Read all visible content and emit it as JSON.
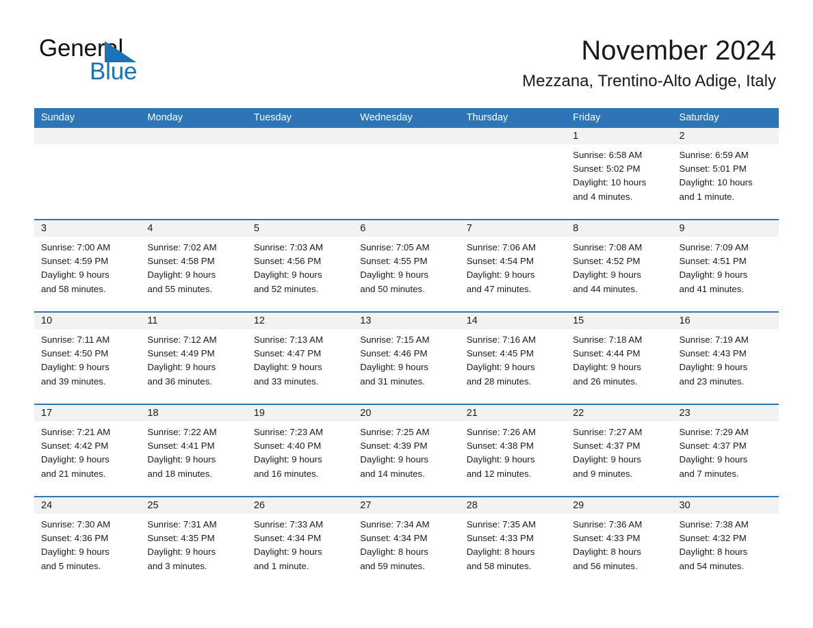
{
  "brand": {
    "line1": "General",
    "line2": "Blue",
    "triangle_color": "#1b72b8"
  },
  "header": {
    "month_title": "November 2024",
    "location": "Mezzana, Trentino-Alto Adige, Italy"
  },
  "colors": {
    "header_blue": "#2e75b6",
    "day_band_gray": "#f2f2f2",
    "text": "#1a1a1a"
  },
  "weekdays": [
    "Sunday",
    "Monday",
    "Tuesday",
    "Wednesday",
    "Thursday",
    "Friday",
    "Saturday"
  ],
  "weeks": [
    [
      {
        "day": "",
        "sunrise": "",
        "sunset": "",
        "daylight_1": "",
        "daylight_2": ""
      },
      {
        "day": "",
        "sunrise": "",
        "sunset": "",
        "daylight_1": "",
        "daylight_2": ""
      },
      {
        "day": "",
        "sunrise": "",
        "sunset": "",
        "daylight_1": "",
        "daylight_2": ""
      },
      {
        "day": "",
        "sunrise": "",
        "sunset": "",
        "daylight_1": "",
        "daylight_2": ""
      },
      {
        "day": "",
        "sunrise": "",
        "sunset": "",
        "daylight_1": "",
        "daylight_2": ""
      },
      {
        "day": "1",
        "sunrise": "Sunrise: 6:58 AM",
        "sunset": "Sunset: 5:02 PM",
        "daylight_1": "Daylight: 10 hours",
        "daylight_2": "and 4 minutes."
      },
      {
        "day": "2",
        "sunrise": "Sunrise: 6:59 AM",
        "sunset": "Sunset: 5:01 PM",
        "daylight_1": "Daylight: 10 hours",
        "daylight_2": "and 1 minute."
      }
    ],
    [
      {
        "day": "3",
        "sunrise": "Sunrise: 7:00 AM",
        "sunset": "Sunset: 4:59 PM",
        "daylight_1": "Daylight: 9 hours",
        "daylight_2": "and 58 minutes."
      },
      {
        "day": "4",
        "sunrise": "Sunrise: 7:02 AM",
        "sunset": "Sunset: 4:58 PM",
        "daylight_1": "Daylight: 9 hours",
        "daylight_2": "and 55 minutes."
      },
      {
        "day": "5",
        "sunrise": "Sunrise: 7:03 AM",
        "sunset": "Sunset: 4:56 PM",
        "daylight_1": "Daylight: 9 hours",
        "daylight_2": "and 52 minutes."
      },
      {
        "day": "6",
        "sunrise": "Sunrise: 7:05 AM",
        "sunset": "Sunset: 4:55 PM",
        "daylight_1": "Daylight: 9 hours",
        "daylight_2": "and 50 minutes."
      },
      {
        "day": "7",
        "sunrise": "Sunrise: 7:06 AM",
        "sunset": "Sunset: 4:54 PM",
        "daylight_1": "Daylight: 9 hours",
        "daylight_2": "and 47 minutes."
      },
      {
        "day": "8",
        "sunrise": "Sunrise: 7:08 AM",
        "sunset": "Sunset: 4:52 PM",
        "daylight_1": "Daylight: 9 hours",
        "daylight_2": "and 44 minutes."
      },
      {
        "day": "9",
        "sunrise": "Sunrise: 7:09 AM",
        "sunset": "Sunset: 4:51 PM",
        "daylight_1": "Daylight: 9 hours",
        "daylight_2": "and 41 minutes."
      }
    ],
    [
      {
        "day": "10",
        "sunrise": "Sunrise: 7:11 AM",
        "sunset": "Sunset: 4:50 PM",
        "daylight_1": "Daylight: 9 hours",
        "daylight_2": "and 39 minutes."
      },
      {
        "day": "11",
        "sunrise": "Sunrise: 7:12 AM",
        "sunset": "Sunset: 4:49 PM",
        "daylight_1": "Daylight: 9 hours",
        "daylight_2": "and 36 minutes."
      },
      {
        "day": "12",
        "sunrise": "Sunrise: 7:13 AM",
        "sunset": "Sunset: 4:47 PM",
        "daylight_1": "Daylight: 9 hours",
        "daylight_2": "and 33 minutes."
      },
      {
        "day": "13",
        "sunrise": "Sunrise: 7:15 AM",
        "sunset": "Sunset: 4:46 PM",
        "daylight_1": "Daylight: 9 hours",
        "daylight_2": "and 31 minutes."
      },
      {
        "day": "14",
        "sunrise": "Sunrise: 7:16 AM",
        "sunset": "Sunset: 4:45 PM",
        "daylight_1": "Daylight: 9 hours",
        "daylight_2": "and 28 minutes."
      },
      {
        "day": "15",
        "sunrise": "Sunrise: 7:18 AM",
        "sunset": "Sunset: 4:44 PM",
        "daylight_1": "Daylight: 9 hours",
        "daylight_2": "and 26 minutes."
      },
      {
        "day": "16",
        "sunrise": "Sunrise: 7:19 AM",
        "sunset": "Sunset: 4:43 PM",
        "daylight_1": "Daylight: 9 hours",
        "daylight_2": "and 23 minutes."
      }
    ],
    [
      {
        "day": "17",
        "sunrise": "Sunrise: 7:21 AM",
        "sunset": "Sunset: 4:42 PM",
        "daylight_1": "Daylight: 9 hours",
        "daylight_2": "and 21 minutes."
      },
      {
        "day": "18",
        "sunrise": "Sunrise: 7:22 AM",
        "sunset": "Sunset: 4:41 PM",
        "daylight_1": "Daylight: 9 hours",
        "daylight_2": "and 18 minutes."
      },
      {
        "day": "19",
        "sunrise": "Sunrise: 7:23 AM",
        "sunset": "Sunset: 4:40 PM",
        "daylight_1": "Daylight: 9 hours",
        "daylight_2": "and 16 minutes."
      },
      {
        "day": "20",
        "sunrise": "Sunrise: 7:25 AM",
        "sunset": "Sunset: 4:39 PM",
        "daylight_1": "Daylight: 9 hours",
        "daylight_2": "and 14 minutes."
      },
      {
        "day": "21",
        "sunrise": "Sunrise: 7:26 AM",
        "sunset": "Sunset: 4:38 PM",
        "daylight_1": "Daylight: 9 hours",
        "daylight_2": "and 12 minutes."
      },
      {
        "day": "22",
        "sunrise": "Sunrise: 7:27 AM",
        "sunset": "Sunset: 4:37 PM",
        "daylight_1": "Daylight: 9 hours",
        "daylight_2": "and 9 minutes."
      },
      {
        "day": "23",
        "sunrise": "Sunrise: 7:29 AM",
        "sunset": "Sunset: 4:37 PM",
        "daylight_1": "Daylight: 9 hours",
        "daylight_2": "and 7 minutes."
      }
    ],
    [
      {
        "day": "24",
        "sunrise": "Sunrise: 7:30 AM",
        "sunset": "Sunset: 4:36 PM",
        "daylight_1": "Daylight: 9 hours",
        "daylight_2": "and 5 minutes."
      },
      {
        "day": "25",
        "sunrise": "Sunrise: 7:31 AM",
        "sunset": "Sunset: 4:35 PM",
        "daylight_1": "Daylight: 9 hours",
        "daylight_2": "and 3 minutes."
      },
      {
        "day": "26",
        "sunrise": "Sunrise: 7:33 AM",
        "sunset": "Sunset: 4:34 PM",
        "daylight_1": "Daylight: 9 hours",
        "daylight_2": "and 1 minute."
      },
      {
        "day": "27",
        "sunrise": "Sunrise: 7:34 AM",
        "sunset": "Sunset: 4:34 PM",
        "daylight_1": "Daylight: 8 hours",
        "daylight_2": "and 59 minutes."
      },
      {
        "day": "28",
        "sunrise": "Sunrise: 7:35 AM",
        "sunset": "Sunset: 4:33 PM",
        "daylight_1": "Daylight: 8 hours",
        "daylight_2": "and 58 minutes."
      },
      {
        "day": "29",
        "sunrise": "Sunrise: 7:36 AM",
        "sunset": "Sunset: 4:33 PM",
        "daylight_1": "Daylight: 8 hours",
        "daylight_2": "and 56 minutes."
      },
      {
        "day": "30",
        "sunrise": "Sunrise: 7:38 AM",
        "sunset": "Sunset: 4:32 PM",
        "daylight_1": "Daylight: 8 hours",
        "daylight_2": "and 54 minutes."
      }
    ]
  ]
}
